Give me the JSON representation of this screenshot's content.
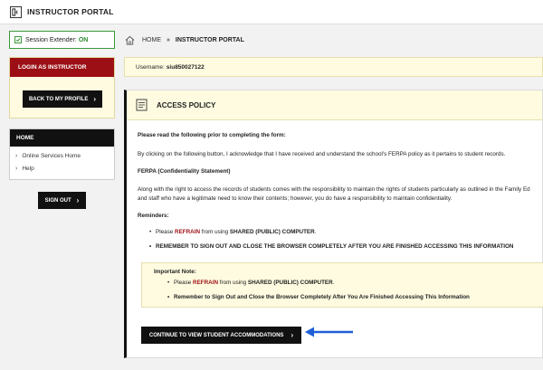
{
  "header": {
    "title": "INSTRUCTOR PORTAL",
    "logo_icon": "portal-logo-icon"
  },
  "sidebar": {
    "session_label": "Session Extender:",
    "session_status": "ON",
    "login_heading": "LOGIN AS INSTRUCTOR",
    "back_button": "BACK TO MY PROFILE",
    "home_heading": "HOME",
    "home_items": [
      {
        "label": "Online Services Home"
      },
      {
        "label": "Help"
      }
    ],
    "signout_button": "SIGN OUT"
  },
  "breadcrumb": {
    "home": "HOME",
    "current": "INSTRUCTOR PORTAL"
  },
  "user": {
    "label": "Username:",
    "value": "siu850027122"
  },
  "policy": {
    "title": "ACCESS POLICY",
    "intro": "Please read the following prior to completing the form:",
    "ack": "By clicking on the following button, I acknowledge that I have received and understand the school's FERPA policy as it pertains to student records.",
    "ferpa_heading": "FERPA (Confidentiality Statement)",
    "ferpa_line1": "Along with the right to access the records of students comes with the responsibility to maintain the rights of students particularly as outlined in the Family Ed",
    "ferpa_line2": "and staff who have a legitimate need to know their contents; however, you do have a responsibility to maintain confidentiality.",
    "reminders_heading": "Reminders:",
    "reminder1_pre": "Please ",
    "reminder1_em": "REFRAIN",
    "reminder1_post": " from using ",
    "reminder1_strong": "SHARED (PUBLIC) COMPUTER",
    "reminder1_end": ".",
    "reminder2": "REMEMBER TO SIGN OUT AND CLOSE THE BROWSER COMPLETELY AFTER YOU ARE FINISHED ACCESSING THIS INFORMATION",
    "note_heading": "Important Note:",
    "note1_pre": "Please ",
    "note1_em": "REFRAIN",
    "note1_post": " from using ",
    "note1_strong": "SHARED (PUBLIC) COMPUTER",
    "note1_end": ".",
    "note2": "Remember to Sign Out and Close the Browser Completely After You Are Finished Accessing This Information",
    "continue_button": "CONTINUE TO VIEW STUDENT ACCOMMODATIONS"
  },
  "colors": {
    "brand_red": "#9c0f14",
    "status_green": "#2d8a2d",
    "annotation_blue": "#1f5fd6",
    "note_bg": "#fffbe0"
  }
}
